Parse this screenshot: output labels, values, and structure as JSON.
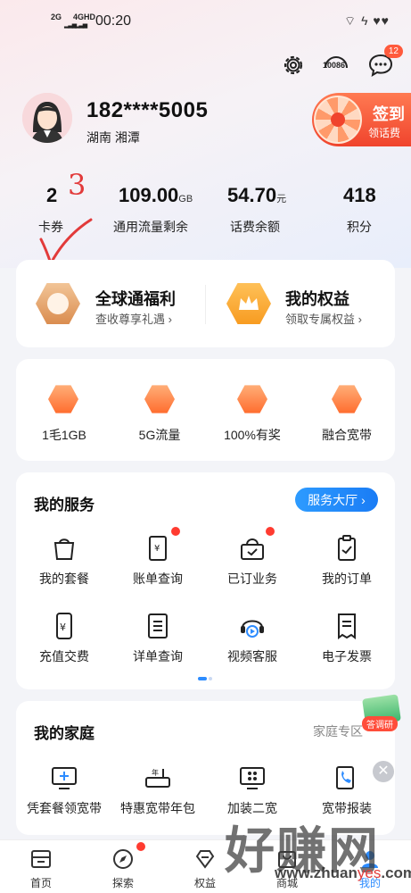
{
  "status_bar": {
    "signal_1": "2G",
    "signal_2": "4GHD",
    "time": "00:20",
    "right_icons": "⌔ ϟ ♥♥"
  },
  "header": {
    "settings_icon": "gear-icon",
    "service_number": "10086",
    "message_count": "12"
  },
  "profile": {
    "phone": "182****5005",
    "location": "湖南  湘潭"
  },
  "checkin": {
    "title": "签到",
    "subtitle": "领话费"
  },
  "stats": [
    {
      "value": "2",
      "unit": "",
      "label": "卡券"
    },
    {
      "value": "109.00",
      "unit": "GB",
      "label": "通用流量剩余"
    },
    {
      "value": "54.70",
      "unit": "元",
      "label": "话费余额"
    },
    {
      "value": "418",
      "unit": "",
      "label": "积分"
    }
  ],
  "annotation": {
    "number": "3"
  },
  "benefits": [
    {
      "title": "全球通福利",
      "subtitle": "查收尊享礼遇 ›"
    },
    {
      "title": "我的权益",
      "subtitle": "领取专属权益 ›"
    }
  ],
  "promos": [
    {
      "label": "1毛1GB",
      "icon": "gift-icon"
    },
    {
      "label": "5G流量",
      "icon": "5g-icon"
    },
    {
      "label": "100%有奖",
      "icon": "prize-icon"
    },
    {
      "label": "融合宽带",
      "icon": "router-icon"
    }
  ],
  "services": {
    "title": "我的服务",
    "hall_button": "服务大厅",
    "items": [
      {
        "label": "我的套餐",
        "icon": "bag-icon"
      },
      {
        "label": "账单查询",
        "icon": "bill-icon"
      },
      {
        "label": "已订业务",
        "icon": "subscription-icon"
      },
      {
        "label": "我的订单",
        "icon": "order-icon"
      },
      {
        "label": "充值交费",
        "icon": "recharge-icon"
      },
      {
        "label": "详单查询",
        "icon": "detail-list-icon"
      },
      {
        "label": "视频客服",
        "icon": "video-service-icon"
      },
      {
        "label": "电子发票",
        "icon": "invoice-icon"
      }
    ]
  },
  "family": {
    "title": "我的家庭",
    "zone_link": "家庭专区",
    "survey_label": "答调研",
    "items": [
      {
        "label": "凭套餐领宽带",
        "icon": "monitor-icon"
      },
      {
        "label": "特惠宽带年包",
        "icon": "router-box-icon"
      },
      {
        "label": "加装二宽",
        "icon": "display-icon"
      },
      {
        "label": "宽带报装",
        "icon": "phone-install-icon"
      }
    ]
  },
  "nav": [
    {
      "label": "首页",
      "icon": "home-icon"
    },
    {
      "label": "探索",
      "icon": "compass-icon"
    },
    {
      "label": "权益",
      "icon": "diamond-icon"
    },
    {
      "label": "商城",
      "icon": "shop-icon"
    },
    {
      "label": "我的",
      "icon": "user-icon"
    }
  ],
  "watermark": {
    "big": "好赚网",
    "domain_prefix": "www.zhuan",
    "domain_accent": "yes",
    "domain_suffix": ".com"
  }
}
